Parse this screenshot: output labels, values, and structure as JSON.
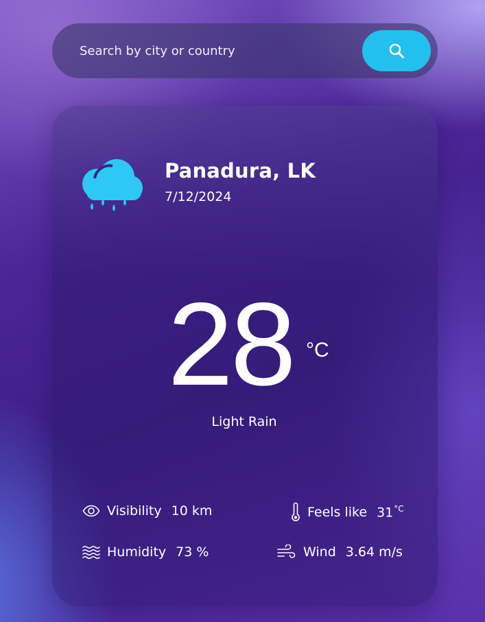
{
  "search": {
    "placeholder": "Search by city or country",
    "icon": "search-icon"
  },
  "weather": {
    "location": "Panadura, LK",
    "date": "7/12/2024",
    "icon": "cloud-rain-icon",
    "temperature": "28",
    "temperature_unit": "°C",
    "condition": "Light Rain"
  },
  "stats": {
    "visibility": {
      "icon": "eye-icon",
      "label": "Visibility",
      "value": "10 km"
    },
    "feels_like": {
      "icon": "thermometer-icon",
      "label": "Feels like",
      "value": "31",
      "unit": "°C"
    },
    "humidity": {
      "icon": "waves-icon",
      "label": "Humidity",
      "value": "73 %"
    },
    "wind": {
      "icon": "wind-icon",
      "label": "Wind",
      "value": "3.64 m/s"
    }
  },
  "colors": {
    "accent": "#22c0ee",
    "icon": "#2ec8f5",
    "text": "#ffffff"
  }
}
